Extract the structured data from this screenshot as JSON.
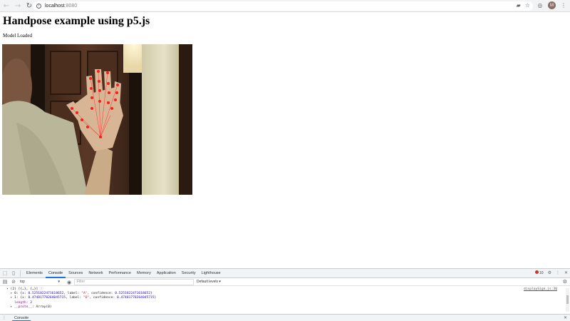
{
  "browser": {
    "url_host": "localhost",
    "url_port": ":8080",
    "avatar_initial": "M",
    "icons": [
      "back-arrow-icon",
      "forward-arrow-icon",
      "reload-icon",
      "info-icon",
      "camera-icon",
      "star-icon",
      "extension-icon",
      "menu-dots-icon"
    ]
  },
  "page": {
    "title": "Handpose example using p5.js",
    "status": "Model Loaded"
  },
  "devtools": {
    "tabs": [
      "Elements",
      "Console",
      "Sources",
      "Network",
      "Performance",
      "Memory",
      "Application",
      "Security",
      "Lighthouse"
    ],
    "active_tab": "Console",
    "error_count": "10",
    "context": "top",
    "filter_placeholder": "Filter",
    "levels": "Default levels ▾",
    "source_link": "displaySign.js:30",
    "console_lines": {
      "l1": "(2) [{…}, {…}] ",
      "l2a": "0: {x: ",
      "l2b": "0.5251822471618652",
      "l2c": ", label: ",
      "l2d": "\"A\"",
      "l2e": ", confidence: ",
      "l2f": "0.5251822471618652",
      "l2g": "}",
      "l3a": "1: {x: ",
      "l3b": "0.47481778264045715",
      "l3c": ", label: ",
      "l3d": "\"D\"",
      "l3e": ", confidence: ",
      "l3f": "0.47481778264045715",
      "l3g": "}",
      "l4a": "length",
      "l4b": ": 2",
      "l5a": "__proto__",
      "l5b": ": Array(0)"
    },
    "drawer_tab": "Console"
  },
  "colors": {
    "keypoint": "#ff1a1a",
    "skeleton": "#ff3333",
    "accent": "#1a73e8",
    "error": "#d93025"
  }
}
